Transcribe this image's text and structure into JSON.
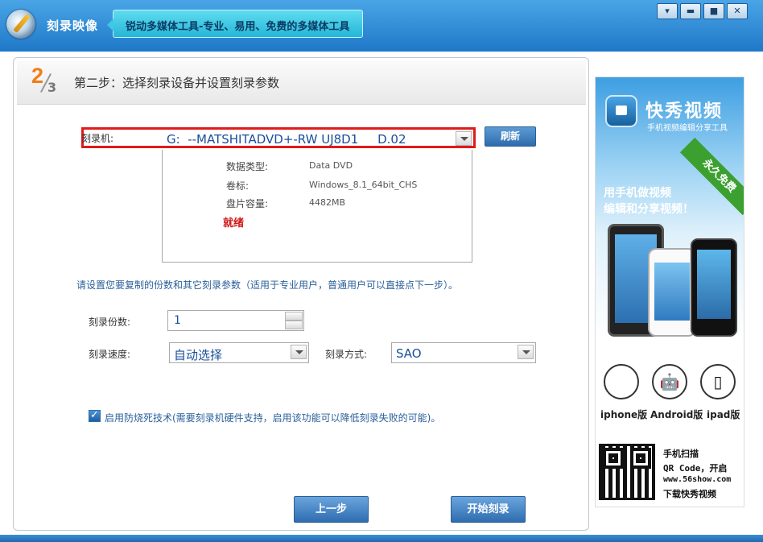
{
  "titlebar": {
    "app_title": "刻录映像",
    "slogan": "锐动多媒体工具-专业、易用、免费的多媒体工具",
    "min_label": "▾",
    "minimize": "▬",
    "maximize": "■",
    "close": "✕"
  },
  "step": {
    "current": "2",
    "total": "3",
    "title": "第二步：选择刻录设备并设置刻录参数"
  },
  "burner": {
    "label": "刻录机:",
    "selected": "G:  --MATSHITADVD+-RW UJ8D1     D.02",
    "refresh_label": "刷新"
  },
  "disc_info": {
    "rows": [
      {
        "label": "数据类型:",
        "value": "Data DVD"
      },
      {
        "label": "卷标:",
        "value": "Windows_8.1_64bit_CHS"
      },
      {
        "label": "盘片容量:",
        "value": "4482MB"
      }
    ],
    "status": "就绪"
  },
  "hint": "请设置您要复制的份数和其它刻录参数（适用于专业用户，普通用户可以直接点下一步）。",
  "params": {
    "copies_label": "刻录份数:",
    "copies_value": "1",
    "speed_label": "刻录速度:",
    "speed_value": "自动选择",
    "mode_label": "刻录方式:",
    "mode_value": "SAO"
  },
  "burnproof": {
    "label": "启用防烧死技术(需要刻录机硬件支持，启用该功能可以降低刻录失败的可能)。",
    "checked": true
  },
  "buttons": {
    "prev": "上一步",
    "start": "开始刻录"
  },
  "ad": {
    "name": "快秀视频",
    "sub": "手机视频编辑分享工具",
    "ribbon": "永久免费",
    "tag1": "用手机做视频",
    "tag2": "编辑和分享视频！",
    "platforms": [
      {
        "icon": "apple-icon",
        "glyph": "",
        "label": "iphone版"
      },
      {
        "icon": "android-icon",
        "glyph": "🤖",
        "label": "Android版"
      },
      {
        "icon": "ipad-icon",
        "glyph": "▯",
        "label": "ipad版"
      }
    ],
    "qr_lines": [
      "手机扫描",
      "QR Code，开启",
      "www.56show.com",
      "下载快秀视频"
    ]
  }
}
